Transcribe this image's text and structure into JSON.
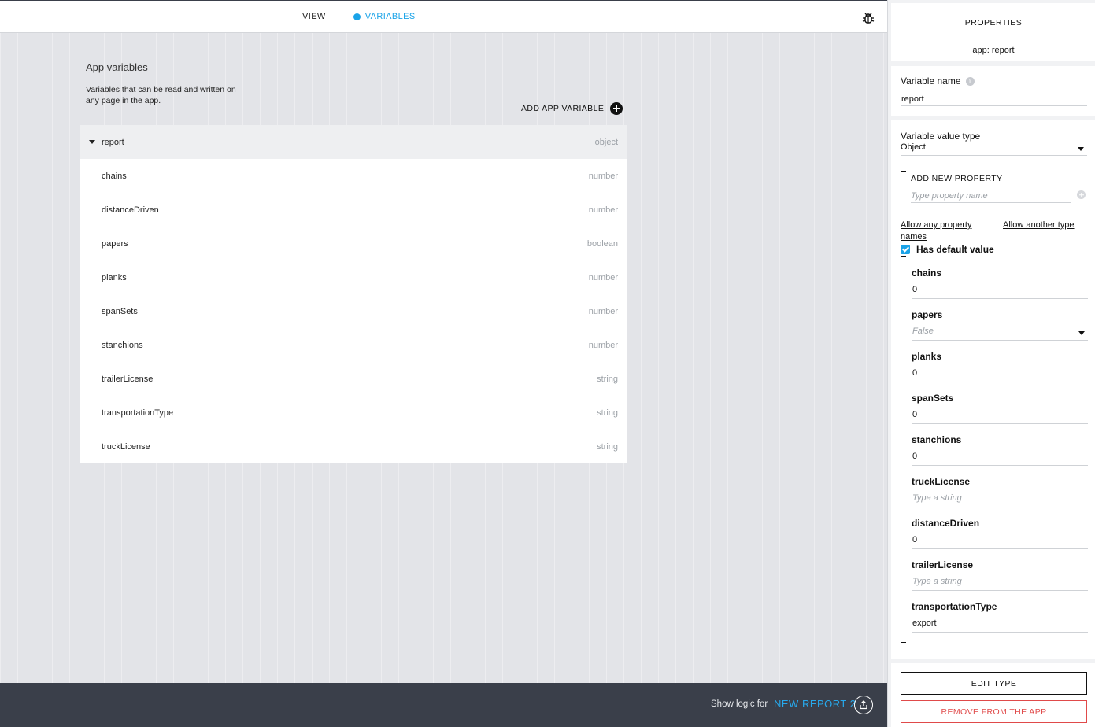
{
  "header": {
    "mode_view": "VIEW",
    "mode_variables": "VARIABLES"
  },
  "app_variables": {
    "title": "App variables",
    "description": "Variables that can be read and written on any page in the app.",
    "add_label": "ADD APP VARIABLE",
    "parent": {
      "name": "report",
      "type": "object"
    },
    "children": [
      {
        "name": "chains",
        "type": "number"
      },
      {
        "name": "distanceDriven",
        "type": "number"
      },
      {
        "name": "papers",
        "type": "boolean"
      },
      {
        "name": "planks",
        "type": "number"
      },
      {
        "name": "spanSets",
        "type": "number"
      },
      {
        "name": "stanchions",
        "type": "number"
      },
      {
        "name": "trailerLicense",
        "type": "string"
      },
      {
        "name": "transportationType",
        "type": "string"
      },
      {
        "name": "truckLicense",
        "type": "string"
      }
    ]
  },
  "footer": {
    "logic_label": "Show logic for",
    "logic_target": "NEW REPORT 2"
  },
  "properties": {
    "title": "PROPERTIES",
    "subtitle": "app: report",
    "variable_name_label": "Variable name",
    "variable_name_value": "report",
    "value_type_label": "Variable value type",
    "value_type_value": "Object",
    "add_new_property_label": "ADD NEW PROPERTY",
    "property_name_placeholder": "Type property name",
    "allow_any_names_link": "Allow any property names",
    "allow_another_type_link": "Allow another type",
    "has_default_label": "Has default value",
    "defaults": [
      {
        "name": "chains",
        "value": "0",
        "placeholder": false,
        "dropdown": false
      },
      {
        "name": "papers",
        "value": "False",
        "placeholder": true,
        "dropdown": true
      },
      {
        "name": "planks",
        "value": "0",
        "placeholder": false,
        "dropdown": false
      },
      {
        "name": "spanSets",
        "value": "0",
        "placeholder": false,
        "dropdown": false
      },
      {
        "name": "stanchions",
        "value": "0",
        "placeholder": false,
        "dropdown": false
      },
      {
        "name": "truckLicense",
        "value": "Type a string",
        "placeholder": true,
        "dropdown": false
      },
      {
        "name": "distanceDriven",
        "value": "0",
        "placeholder": false,
        "dropdown": false
      },
      {
        "name": "trailerLicense",
        "value": "Type a string",
        "placeholder": true,
        "dropdown": false
      },
      {
        "name": "transportationType",
        "value": "export",
        "placeholder": false,
        "dropdown": false
      }
    ],
    "edit_type_label": "EDIT TYPE",
    "remove_label": "REMOVE FROM THE APP"
  },
  "colors": {
    "accent": "#1aa3e8",
    "danger": "#e04a4a",
    "footer_bg": "#3a3f4a"
  },
  "icons": [
    "debug-bug-icon",
    "add-circle-icon",
    "info-icon",
    "caret-down-icon",
    "export-icon",
    "checkbox-checked-icon"
  ]
}
